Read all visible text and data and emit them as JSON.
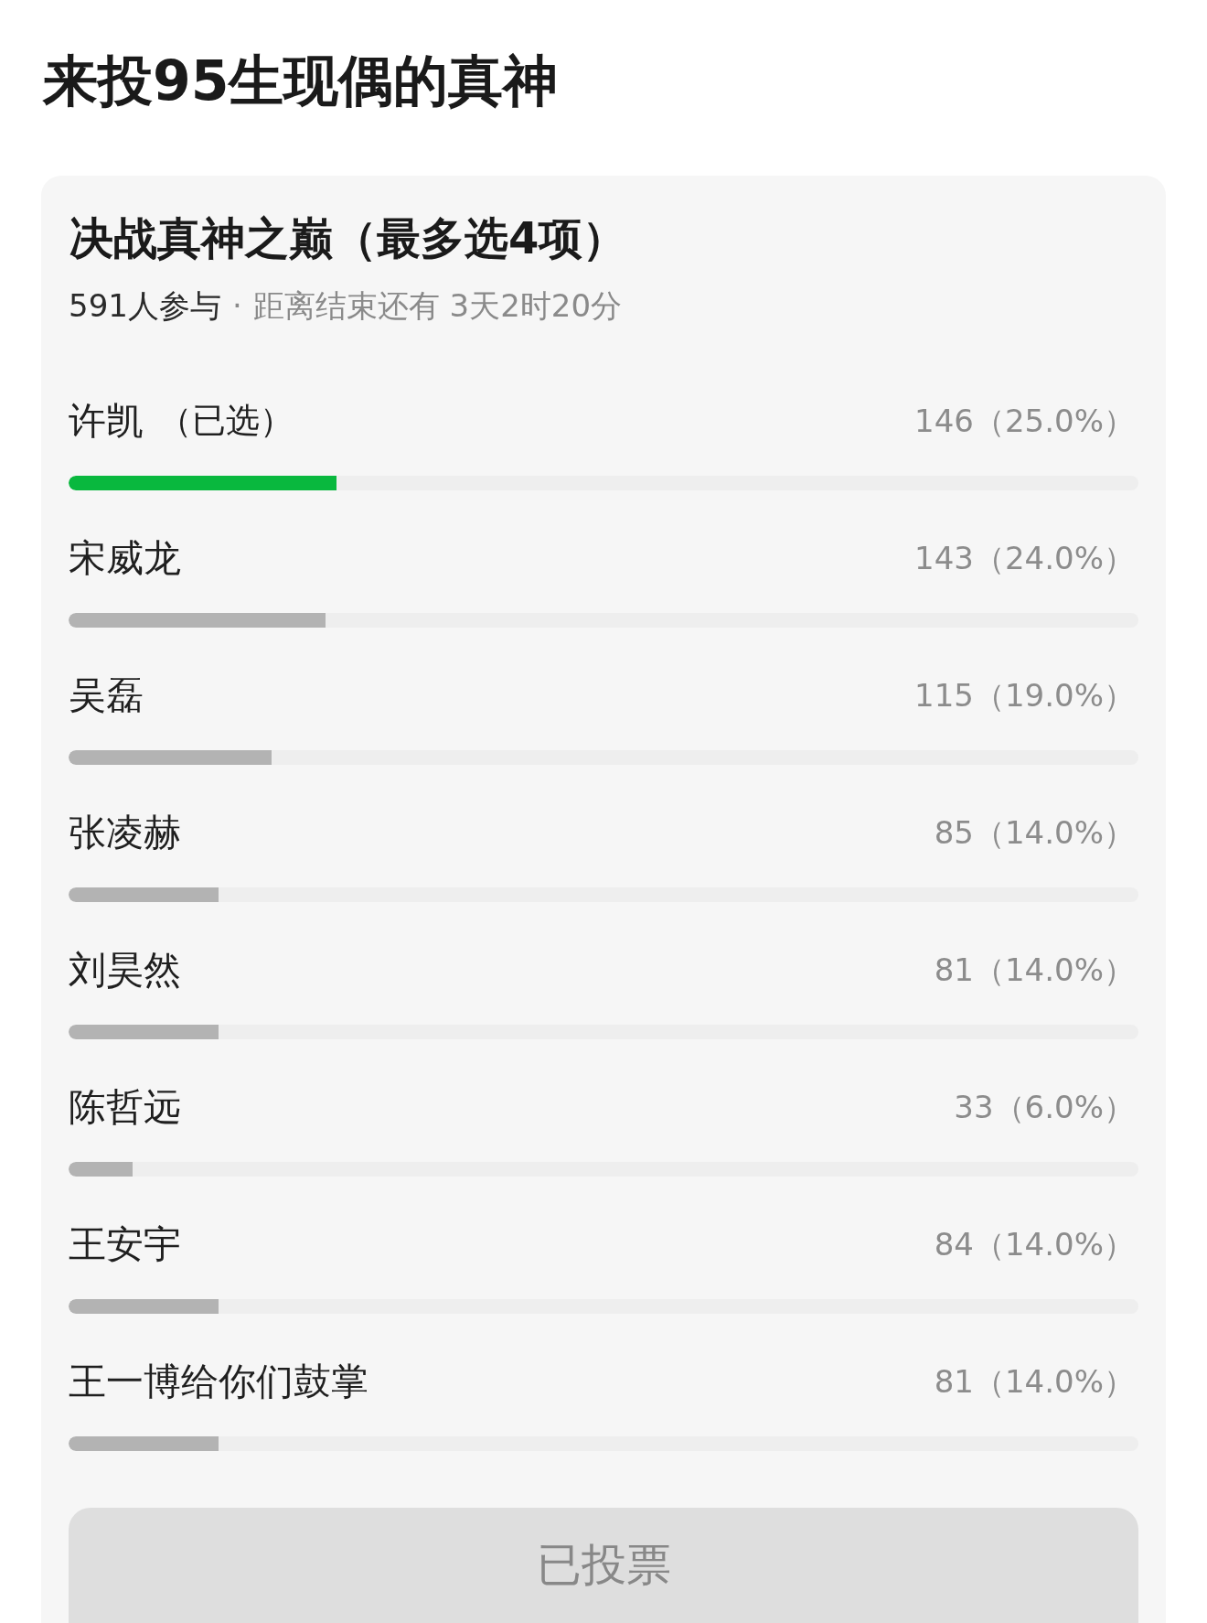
{
  "page_title": "来投95生现偶的真神",
  "poll": {
    "title": "决战真神之巅（最多选4项）",
    "participants": "591人参与",
    "separator": "·",
    "deadline": "距离结束还有 3天2时20分",
    "selected_label": "（已选）",
    "options": [
      {
        "name": "许凯",
        "count": "146（25.0%）",
        "level": 0.25,
        "selected": true
      },
      {
        "name": "宋威龙",
        "count": "143（24.0%）",
        "level": 0.24,
        "selected": false
      },
      {
        "name": "吴磊",
        "count": "115（19.0%）",
        "level": 0.19,
        "selected": false
      },
      {
        "name": "张凌赫",
        "count": "85（14.0%）",
        "level": 0.14,
        "selected": false
      },
      {
        "name": "刘昊然",
        "count": "81（14.0%）",
        "level": 0.14,
        "selected": false
      },
      {
        "name": "陈哲远",
        "count": "33（6.0%）",
        "level": 0.06,
        "selected": false
      },
      {
        "name": "王安宇",
        "count": "84（14.0%）",
        "level": 0.14,
        "selected": false
      },
      {
        "name": "王一博给你们鼓掌",
        "count": "81（14.0%）",
        "level": 0.14,
        "selected": false
      }
    ],
    "button": {
      "label": "已投票",
      "disabled": true
    }
  }
}
